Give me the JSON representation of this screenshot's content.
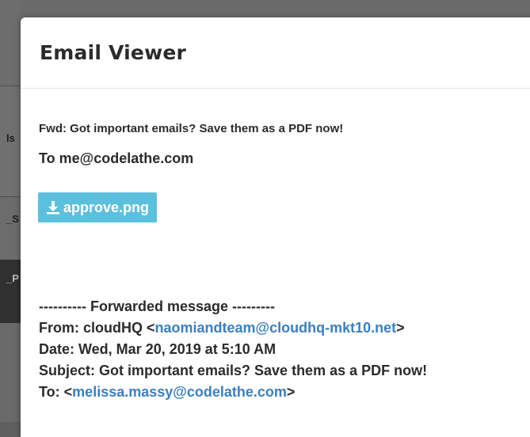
{
  "background": {
    "fragments": [
      "ls",
      "_S",
      "_P"
    ]
  },
  "modal": {
    "title": "Email Viewer",
    "subject": "Fwd: Got important emails? Save them as a PDF now!",
    "to_line": "To me@codelathe.com",
    "attachment": {
      "icon": "download-icon",
      "label": "approve.png",
      "color": "#5bc0de"
    },
    "body": {
      "forward_header": "---------- Forwarded message ---------",
      "from_prefix": "From: cloudHQ <",
      "from_email": "naomiandteam@cloudhq-mkt10.net",
      "from_suffix": ">",
      "date": "Date: Wed, Mar 20, 2019 at 5:10 AM",
      "subject": "Subject: Got important emails? Save them as a PDF now!",
      "to_prefix": "To: <",
      "to_email": "melissa.massy@codelathe.com",
      "to_suffix": ">"
    },
    "link_color": "#3a7fc1"
  }
}
